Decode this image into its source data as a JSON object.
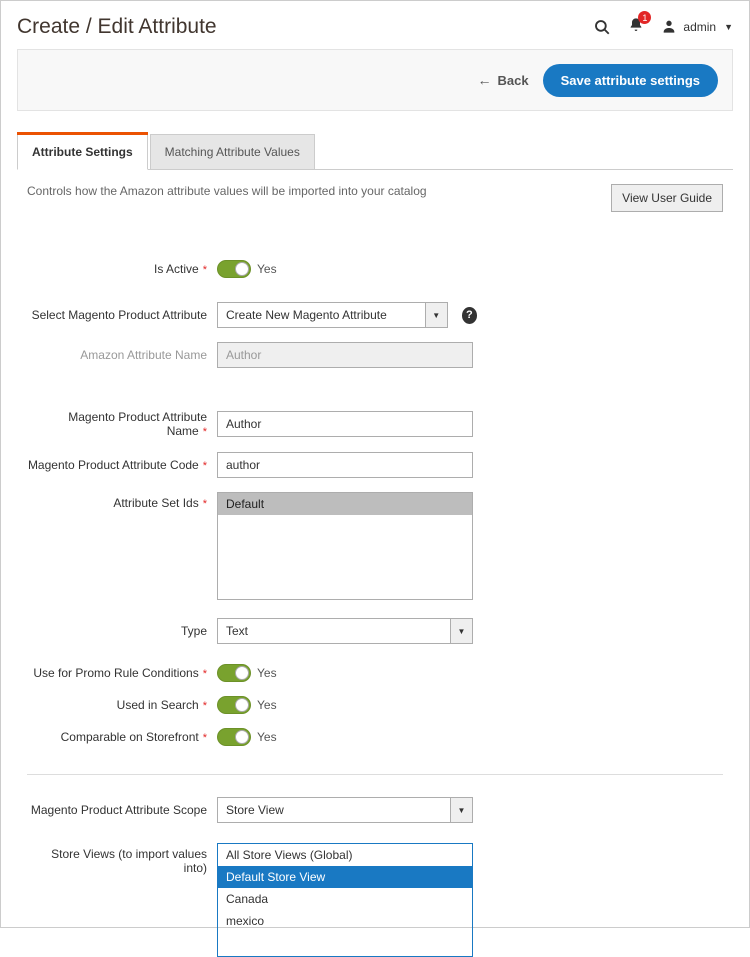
{
  "header": {
    "title": "Create / Edit Attribute",
    "notif_count": "1",
    "user_label": "admin"
  },
  "actions": {
    "back_label": "Back",
    "save_label": "Save attribute settings"
  },
  "tabs": {
    "settings": "Attribute Settings",
    "matching": "Matching Attribute Values"
  },
  "intro": {
    "text": "Controls how the Amazon attribute values will be imported into your catalog",
    "guide_label": "View User Guide"
  },
  "form": {
    "is_active": {
      "label": "Is Active",
      "value_label": "Yes"
    },
    "select_attr": {
      "label": "Select Magento Product Attribute",
      "value": "Create New Magento Attribute"
    },
    "amazon_name": {
      "label": "Amazon Attribute Name",
      "value": "Author"
    },
    "mpa_name": {
      "label": "Magento Product Attribute Name",
      "value": "Author"
    },
    "mpa_code": {
      "label": "Magento Product Attribute Code",
      "value": "author"
    },
    "attr_set": {
      "label": "Attribute Set Ids",
      "options": [
        "Default"
      ],
      "selected": 0
    },
    "type": {
      "label": "Type",
      "value": "Text"
    },
    "promo": {
      "label": "Use for Promo Rule Conditions",
      "value_label": "Yes"
    },
    "search": {
      "label": "Used in Search",
      "value_label": "Yes"
    },
    "comparable": {
      "label": "Comparable on Storefront",
      "value_label": "Yes"
    },
    "scope": {
      "label": "Magento Product Attribute Scope",
      "value": "Store View"
    },
    "store_views": {
      "label": "Store Views (to import values into)",
      "options": [
        "All Store Views (Global)",
        "Default Store View",
        "Canada",
        "mexico"
      ],
      "selected": 1
    }
  }
}
